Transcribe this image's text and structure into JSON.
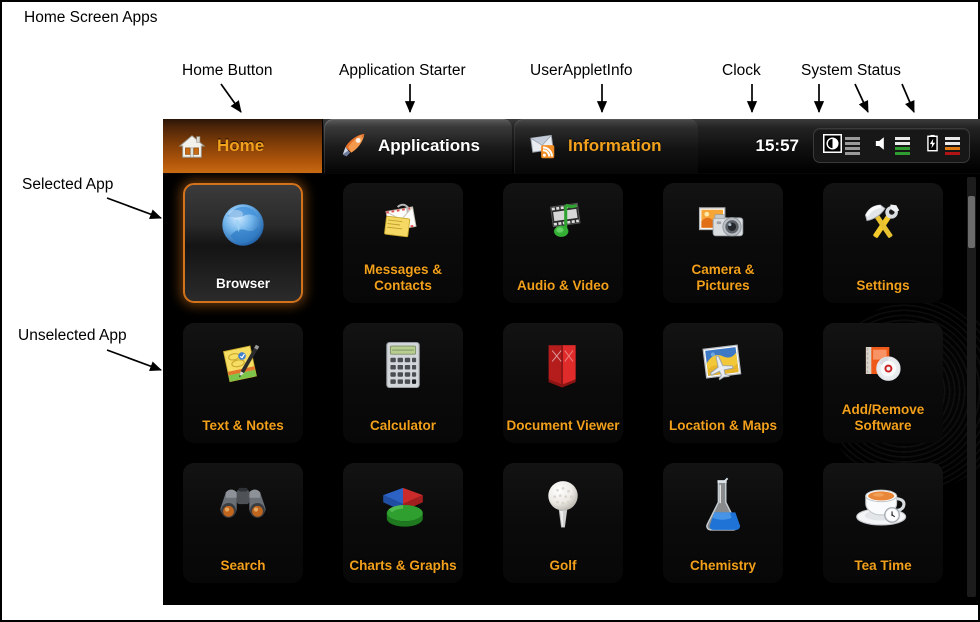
{
  "annotations": {
    "title": "Home Screen Apps",
    "labels": [
      {
        "key": "home_button",
        "text": "Home Button"
      },
      {
        "key": "application_starter",
        "text": "Application Starter"
      },
      {
        "key": "userappletinfo",
        "text": "UserAppletInfo"
      },
      {
        "key": "clock",
        "text": "Clock"
      },
      {
        "key": "system_status",
        "text": "System Status"
      },
      {
        "key": "selected_app",
        "text": "Selected App"
      },
      {
        "key": "unselected_app",
        "text": "Unselected App"
      }
    ]
  },
  "topbar": {
    "tabs": [
      {
        "id": "home",
        "label": "Home",
        "icon": "house-icon",
        "active": false
      },
      {
        "id": "applications",
        "label": "Applications",
        "icon": "rocket-icon",
        "active": true
      },
      {
        "id": "information",
        "label": "Information",
        "icon": "rss-mail-icon",
        "active": false
      }
    ],
    "clock": "15:57",
    "status": [
      {
        "id": "brightness",
        "icon": "brightness-icon",
        "level": 4,
        "total": 4,
        "color": "#8c8c8c"
      },
      {
        "id": "volume",
        "icon": "volume-icon",
        "level": 2,
        "total": 4,
        "color": "#2f9c2f"
      },
      {
        "id": "battery",
        "icon": "battery-icon",
        "level": 2,
        "total": 4,
        "color": "#e07a10"
      }
    ]
  },
  "grid": {
    "scroll_position": "top",
    "apps": [
      {
        "id": "browser",
        "label": "Browser",
        "icon": "globe-icon",
        "selected": true
      },
      {
        "id": "messages",
        "label": "Messages & Contacts",
        "icon": "envelope-icon",
        "selected": false
      },
      {
        "id": "audio_video",
        "label": "Audio & Video",
        "icon": "film-note-icon",
        "selected": false
      },
      {
        "id": "camera",
        "label": "Camera & Pictures",
        "icon": "camera-icon",
        "selected": false
      },
      {
        "id": "settings",
        "label": "Settings",
        "icon": "tools-icon",
        "selected": false
      },
      {
        "id": "text_notes",
        "label": "Text & Notes",
        "icon": "notes-pen-icon",
        "selected": false
      },
      {
        "id": "calculator",
        "label": "Calculator",
        "icon": "calculator-icon",
        "selected": false
      },
      {
        "id": "doc_viewer",
        "label": "Document Viewer",
        "icon": "red-book-icon",
        "selected": false
      },
      {
        "id": "location_maps",
        "label": "Location & Maps",
        "icon": "map-plane-icon",
        "selected": false
      },
      {
        "id": "add_remove",
        "label": "Add/Remove Software",
        "icon": "package-cd-icon",
        "selected": false
      },
      {
        "id": "search",
        "label": "Search",
        "icon": "binoculars-icon",
        "selected": false
      },
      {
        "id": "charts",
        "label": "Charts & Graphs",
        "icon": "pie-chart-icon",
        "selected": false
      },
      {
        "id": "golf",
        "label": "Golf",
        "icon": "golf-ball-icon",
        "selected": false
      },
      {
        "id": "chemistry",
        "label": "Chemistry",
        "icon": "flask-icon",
        "selected": false
      },
      {
        "id": "tea_time",
        "label": "Tea Time",
        "icon": "teacup-icon",
        "selected": false
      }
    ]
  },
  "colors": {
    "accent_orange": "#f2a01b",
    "home_tab_orange": "#b1560a",
    "selected_border": "#d2721b",
    "panel_black": "#000000",
    "text_white": "#ffffff"
  }
}
